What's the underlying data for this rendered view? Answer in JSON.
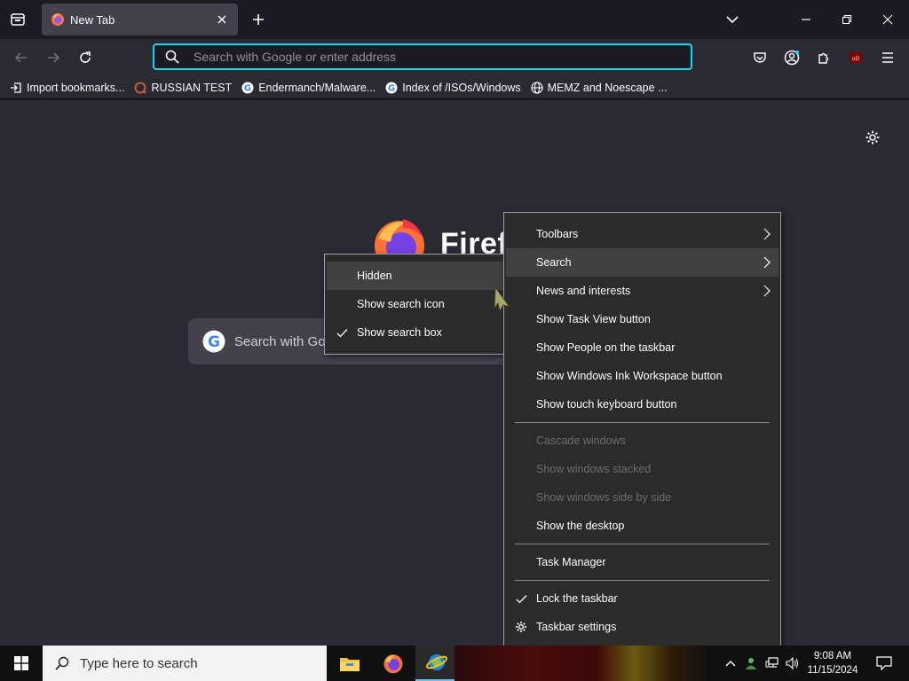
{
  "browser": {
    "tab_title": "New Tab",
    "url_placeholder": "Search with Google or enter address",
    "bookmarks": [
      {
        "label": "Import bookmarks...",
        "icon": "import-icon"
      },
      {
        "label": "RUSSIAN TEST",
        "icon": "site-icon"
      },
      {
        "label": "Endermanch/Malware...",
        "icon": "google-icon"
      },
      {
        "label": "Index of /ISOs/Windows",
        "icon": "google-icon"
      },
      {
        "label": "MEMZ and Noescape ...",
        "icon": "globe-icon"
      }
    ],
    "brand_text": "Firef",
    "newtab_search_text": "Search with Go"
  },
  "submenu": {
    "items": [
      {
        "label": "Hidden",
        "checked": false,
        "highlighted": true
      },
      {
        "label": "Show search icon",
        "checked": false
      },
      {
        "label": "Show search box",
        "checked": true
      }
    ]
  },
  "taskbar_menu": {
    "group1": [
      {
        "label": "Toolbars",
        "arrow": true
      },
      {
        "label": "Search",
        "arrow": true,
        "highlighted": true
      },
      {
        "label": "News and interests",
        "arrow": true
      },
      {
        "label": "Show Task View button"
      },
      {
        "label": "Show People on the taskbar"
      },
      {
        "label": "Show Windows Ink Workspace button"
      },
      {
        "label": "Show touch keyboard button"
      }
    ],
    "group2": [
      {
        "label": "Cascade windows",
        "disabled": true
      },
      {
        "label": "Show windows stacked",
        "disabled": true
      },
      {
        "label": "Show windows side by side",
        "disabled": true
      },
      {
        "label": "Show the desktop"
      }
    ],
    "group3": [
      {
        "label": "Task Manager"
      }
    ],
    "group4": [
      {
        "label": "Lock the taskbar",
        "checked": true
      },
      {
        "label": "Taskbar settings",
        "gear": true
      }
    ]
  },
  "taskbar": {
    "search_placeholder": "Type here to search",
    "time": "9:08 AM",
    "date": "11/15/2024"
  },
  "colors": {
    "accent": "#00ddff",
    "menu_bg": "#2b2b2b",
    "chrome_bg": "#1c1b22"
  }
}
